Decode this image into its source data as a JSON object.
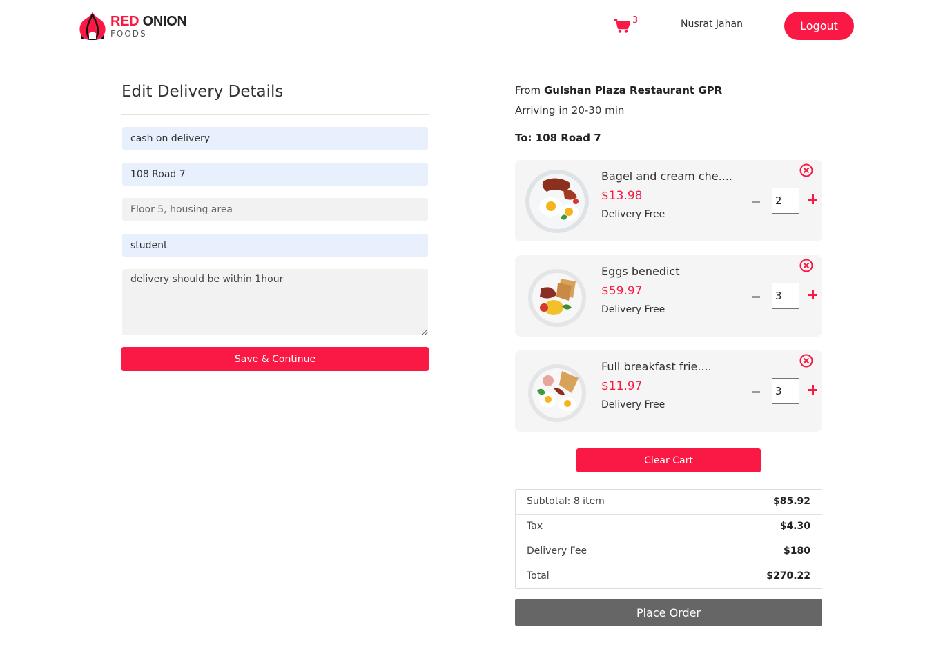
{
  "header": {
    "brand_red": "RED",
    "brand_dark": "ONION",
    "brand_sub": "FOODS",
    "cart_count": "3",
    "username": "Nusrat Jahan",
    "logout_label": "Logout"
  },
  "form": {
    "title": "Edit Delivery Details",
    "fields": [
      {
        "value": "cash on delivery",
        "placeholder": ""
      },
      {
        "value": "108 Road 7",
        "placeholder": ""
      },
      {
        "value": "",
        "placeholder": "Floor 5, housing area"
      },
      {
        "value": "student",
        "placeholder": ""
      }
    ],
    "instructions": "delivery should be within 1hour",
    "save_label": "Save & Continue"
  },
  "order": {
    "from_label": "From",
    "restaurant": "Gulshan Plaza Restaurant GPR",
    "arriving": "Arriving in 20-30 min",
    "to": "To: 108 Road 7",
    "items": [
      {
        "name": "Bagel and cream che....",
        "price": "$13.98",
        "delivery": "Delivery Free",
        "qty": "2"
      },
      {
        "name": "Eggs benedict",
        "price": "$59.97",
        "delivery": "Delivery Free",
        "qty": "3"
      },
      {
        "name": "Full breakfast frie....",
        "price": "$11.97",
        "delivery": "Delivery Free",
        "qty": "3"
      }
    ],
    "clear_label": "Clear Cart",
    "summary": [
      {
        "label": "Subtotal: 8 item",
        "value": "$85.92"
      },
      {
        "label": "Tax",
        "value": "$4.30"
      },
      {
        "label": "Delivery Fee",
        "value": "$180"
      },
      {
        "label": "Total",
        "value": "$270.22"
      }
    ],
    "place_label": "Place Order"
  },
  "colors": {
    "accent": "#f91944",
    "place_button": "#666666",
    "filled_field": "#e8f0fe",
    "empty_field": "#f2f2f2"
  }
}
